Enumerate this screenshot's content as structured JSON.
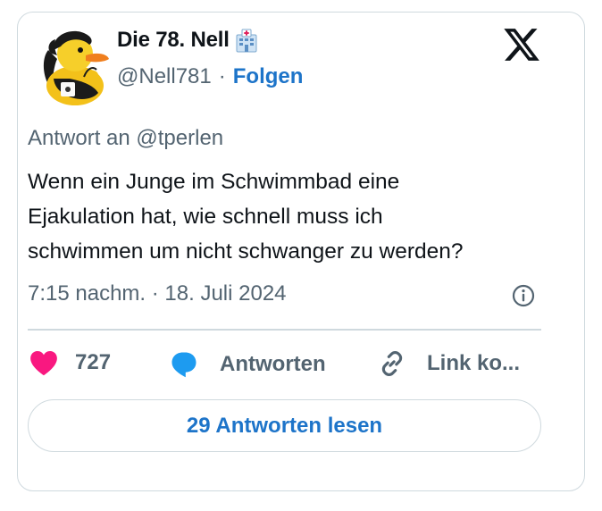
{
  "author": {
    "display_name": "Die 78. Nell",
    "handle": "@Nell781",
    "separator": "·",
    "follow_label": "Folgen",
    "avatar_icon": "rubber-duck-avatar",
    "name_badge_icon": "hospital-emoji-icon"
  },
  "platform_icon": "x-logo-icon",
  "tweet": {
    "reply_to": "Antwort an @tperlen",
    "text": "Wenn ein Junge im Schwimmbad eine\nEjakulation hat, wie schnell muss ich\nschwimmen um nicht schwanger zu werden?",
    "timestamp": "7:15 nachm. · 18. Juli 2024"
  },
  "actions": {
    "like_count": "727",
    "reply_label": "Antworten",
    "link_label": "Link ko..."
  },
  "read_replies_label": "29 Antworten lesen",
  "colors": {
    "like": "#f91880",
    "reply": "#1d9bf0",
    "link_accent": "#1d74c9",
    "secondary_text": "#536471",
    "border": "#cfd9de"
  }
}
